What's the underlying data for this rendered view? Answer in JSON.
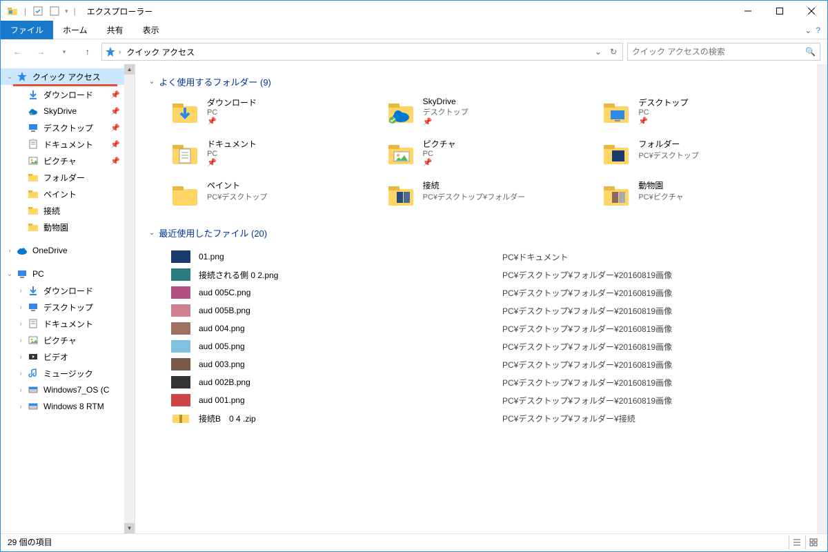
{
  "title": "エクスプローラー",
  "ribbon": {
    "file": "ファイル",
    "tabs": [
      "ホーム",
      "共有",
      "表示"
    ]
  },
  "address": {
    "text": "クイック アクセス"
  },
  "search": {
    "placeholder": "クイック アクセスの検索"
  },
  "sidebar": {
    "quick_access": "クイック アクセス",
    "items": [
      {
        "label": "ダウンロード",
        "pinned": true
      },
      {
        "label": "SkyDrive",
        "pinned": true
      },
      {
        "label": "デスクトップ",
        "pinned": true
      },
      {
        "label": "ドキュメント",
        "pinned": true
      },
      {
        "label": "ピクチャ",
        "pinned": true
      },
      {
        "label": "フォルダー"
      },
      {
        "label": "ペイント"
      },
      {
        "label": "接続"
      },
      {
        "label": "動物園"
      }
    ],
    "onedrive": "OneDrive",
    "pc": "PC",
    "pc_items": [
      {
        "label": "ダウンロード"
      },
      {
        "label": "デスクトップ"
      },
      {
        "label": "ドキュメント"
      },
      {
        "label": "ピクチャ"
      },
      {
        "label": "ビデオ"
      },
      {
        "label": "ミュージック"
      },
      {
        "label": "Windows7_OS (C"
      },
      {
        "label": "Windows 8 RTM"
      }
    ]
  },
  "sections": {
    "frequent": "よく使用するフォルダー (9)",
    "recent": "最近使用したファイル (20)"
  },
  "folders": [
    {
      "name": "ダウンロード",
      "sub": "PC",
      "pin": true,
      "icon": "download"
    },
    {
      "name": "SkyDrive",
      "sub": "デスクトップ",
      "pin": true,
      "icon": "skydrive"
    },
    {
      "name": "デスクトップ",
      "sub": "PC",
      "pin": true,
      "icon": "desktop"
    },
    {
      "name": "ドキュメント",
      "sub": "PC",
      "pin": true,
      "icon": "document"
    },
    {
      "name": "ピクチャ",
      "sub": "PC",
      "pin": true,
      "icon": "picture"
    },
    {
      "name": "フォルダー",
      "sub": "PC¥デスクトップ",
      "icon": "folder-img"
    },
    {
      "name": "ペイント",
      "sub": "PC¥デスクトップ",
      "icon": "folder"
    },
    {
      "name": "接続",
      "sub": "PC¥デスクトップ¥フォルダー",
      "icon": "folder-img2"
    },
    {
      "name": "動物園",
      "sub": "PC¥ピクチャ",
      "icon": "folder-img3"
    }
  ],
  "files": [
    {
      "name": "01.png",
      "path": "PC¥ドキュメント",
      "thumb": "t1"
    },
    {
      "name": "接続される側 0 2.png",
      "path": "PC¥デスクトップ¥フォルダー¥20160819画像",
      "thumb": "t2"
    },
    {
      "name": "aud 005C.png",
      "path": "PC¥デスクトップ¥フォルダー¥20160819画像",
      "thumb": "t3"
    },
    {
      "name": "aud 005B.png",
      "path": "PC¥デスクトップ¥フォルダー¥20160819画像",
      "thumb": "t4"
    },
    {
      "name": "aud 004.png",
      "path": "PC¥デスクトップ¥フォルダー¥20160819画像",
      "thumb": "t5"
    },
    {
      "name": "aud 005.png",
      "path": "PC¥デスクトップ¥フォルダー¥20160819画像",
      "thumb": "t6"
    },
    {
      "name": "aud 003.png",
      "path": "PC¥デスクトップ¥フォルダー¥20160819画像",
      "thumb": "t7"
    },
    {
      "name": "aud 002B.png",
      "path": "PC¥デスクトップ¥フォルダー¥20160819画像",
      "thumb": "t8"
    },
    {
      "name": "aud 001.png",
      "path": "PC¥デスクトップ¥フォルダー¥20160819画像",
      "thumb": "t9"
    },
    {
      "name": "接続B　0 4 .zip",
      "path": "PC¥デスクトップ¥フォルダー¥接続",
      "thumb": "zip"
    }
  ],
  "status": "29 個の項目"
}
